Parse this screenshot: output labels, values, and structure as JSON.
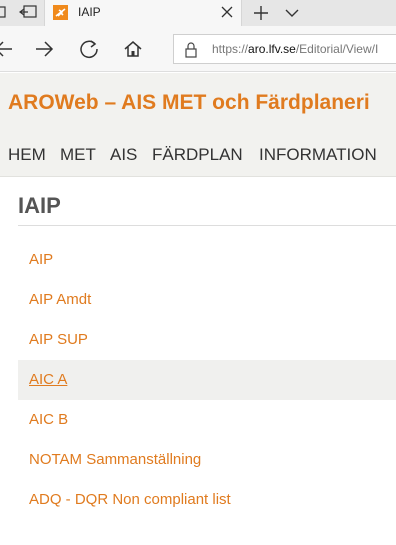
{
  "browser": {
    "tab_title": "IAIP",
    "url_prefix": "https://",
    "url_domain": "aro.lfv.se",
    "url_path": "/Editorial/View/I"
  },
  "site": {
    "title": "AROWeb – AIS MET och Färdplaneri"
  },
  "nav": [
    "HEM",
    "MET",
    "AIS",
    "FÄRDPLAN",
    "INFORMATION"
  ],
  "page": {
    "title": "IAIP",
    "links": [
      "AIP",
      "AIP Amdt",
      "AIP SUP",
      "AIC A",
      "AIC B",
      "NOTAM Sammanställning",
      "ADQ - DQR Non compliant list"
    ],
    "active_link": "AIC A"
  },
  "colors": {
    "accent": "#e07b1f",
    "header_bg": "#f2f2ef"
  }
}
